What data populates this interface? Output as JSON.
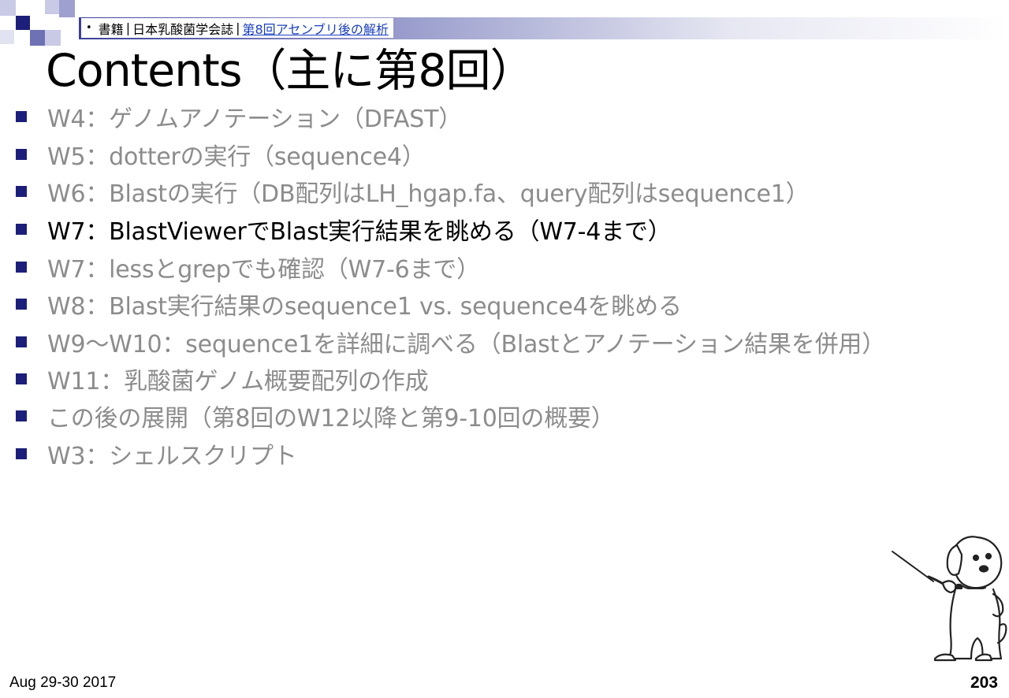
{
  "header": {
    "breadcrumb": {
      "bullet": "•",
      "part1": "書籍",
      "sep1": "|",
      "part2": "日本乳酸菌学会誌",
      "sep2": "|",
      "link": "第8回アセンブリ後の解析"
    }
  },
  "title": "Contents（主に第8回）",
  "items": [
    {
      "text": "W4：ゲノムアノテーション（DFAST）"
    },
    {
      "text": "W5：dotterの実行（sequence4）"
    },
    {
      "text": "W6：Blastの実行（DB配列はLH_hgap.fa、query配列はsequence1）"
    },
    {
      "text": "W7：BlastViewerでBlast実行結果を眺める（W7-4まで）"
    },
    {
      "text": "W7：lessとgrepでも確認（W7-6まで）"
    },
    {
      "text": "W8：Blast実行結果のsequence1 vs. sequence4を眺める"
    },
    {
      "text": "W9～W10：sequence1を詳細に調べる（Blastとアノテーション結果を併用）"
    },
    {
      "text": "W11：乳酸菌ゲノム概要配列の作成"
    },
    {
      "text": "この後の展開（第8回のW12以降と第9-10回の概要）"
    },
    {
      "text": "W3：シェルスクリプト"
    }
  ],
  "footer": {
    "date": "Aug 29-30 2017",
    "page_number": "203"
  },
  "colors": {
    "bullet": "#1c1f7a",
    "active_text": "#000000",
    "inactive_text": "#8c8c8c",
    "link": "#1a3fc0"
  },
  "active_item_index": 3,
  "icons": {
    "mascot": "dog-pointer-illustration",
    "list_bullet": "square-bullet-icon"
  }
}
